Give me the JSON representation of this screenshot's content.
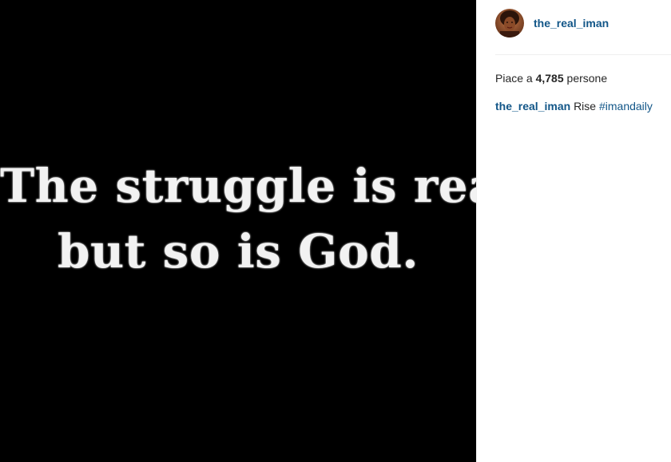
{
  "post": {
    "quote_lines": [
      "The struggle is real,",
      "but so is God."
    ]
  },
  "header": {
    "username": "the_real_iman"
  },
  "likes": {
    "prefix": "Piace a",
    "count": "4,785",
    "suffix": "persone"
  },
  "caption": {
    "username": "the_real_iman",
    "text": "Rise",
    "hashtag": "#imandaily"
  },
  "colors": {
    "link": "#125688",
    "text": "#262626",
    "image_bg": "#000000",
    "divider": "#efefef"
  },
  "icons": {
    "avatar": "profile-photo"
  }
}
